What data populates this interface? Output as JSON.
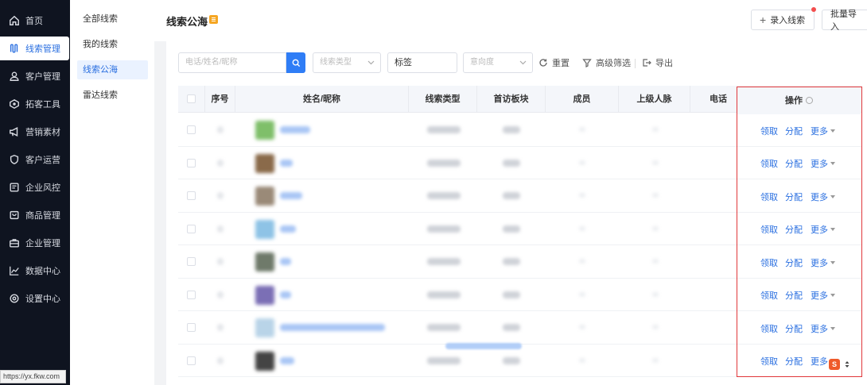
{
  "nav": {
    "items": [
      {
        "label": "首页",
        "icon": "home-icon"
      },
      {
        "label": "线索管理",
        "icon": "leads-icon",
        "active": true
      },
      {
        "label": "客户管理",
        "icon": "customer-icon"
      },
      {
        "label": "拓客工具",
        "icon": "tools-icon"
      },
      {
        "label": "营销素材",
        "icon": "megaphone-icon"
      },
      {
        "label": "客户运营",
        "icon": "operation-icon"
      },
      {
        "label": "企业风控",
        "icon": "risk-icon"
      },
      {
        "label": "商品管理",
        "icon": "product-icon"
      },
      {
        "label": "企业管理",
        "icon": "briefcase-icon"
      },
      {
        "label": "数据中心",
        "icon": "chart-icon"
      },
      {
        "label": "设置中心",
        "icon": "settings-icon"
      }
    ]
  },
  "submenu": {
    "items": [
      {
        "label": "全部线索"
      },
      {
        "label": "我的线索"
      },
      {
        "label": "线索公海",
        "active": true
      },
      {
        "label": "雷达线索"
      }
    ]
  },
  "header": {
    "title": "线索公海",
    "add_button": "录入线索",
    "batch_button": "批量导入"
  },
  "filters": {
    "search_placeholder": "电话/姓名/昵称",
    "type_placeholder": "线索类型",
    "tag_value": "标签",
    "intent_placeholder": "意向度",
    "reset": "重置",
    "advanced": "高级筛选",
    "export": "导出"
  },
  "table": {
    "columns": [
      "序号",
      "姓名/昵称",
      "线索类型",
      "首访板块",
      "成员",
      "上级人脉",
      "电话"
    ],
    "ops_header": "操作"
  },
  "row_actions": {
    "claim": "领取",
    "assign": "分配",
    "more": "更多"
  },
  "status_bar": {
    "url": "https://yx.fkw.com"
  },
  "colors": {
    "accent": "#2f7df6",
    "nav_bg": "#0f1420",
    "highlight_border": "#e0373a"
  }
}
